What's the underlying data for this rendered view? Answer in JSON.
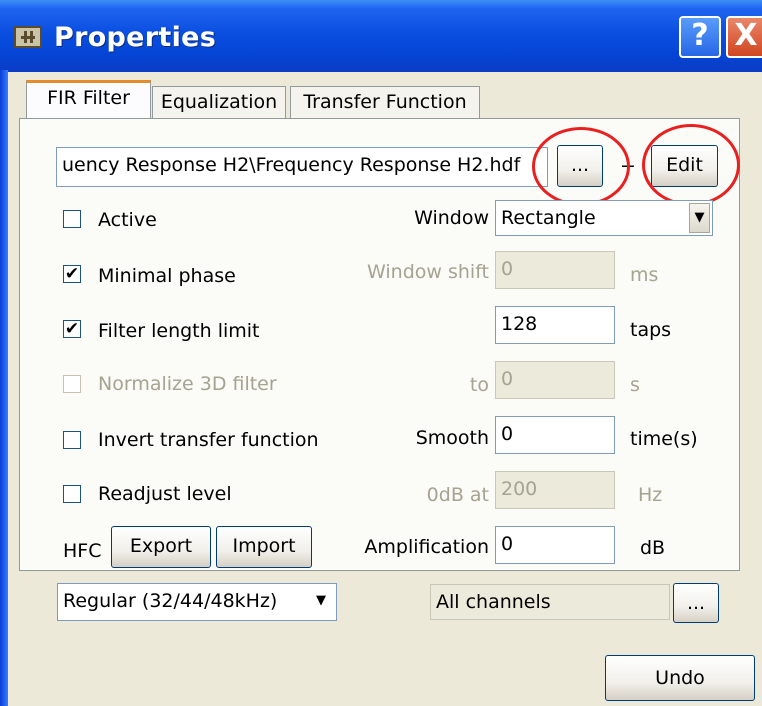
{
  "window": {
    "title": "Properties",
    "help_glyph": "?",
    "close_glyph": "X"
  },
  "tabs": [
    {
      "label": "FIR Filter",
      "active": true
    },
    {
      "label": "Equalization",
      "active": false
    },
    {
      "label": "Transfer Function",
      "active": false
    }
  ],
  "file": {
    "path": "uency Response H2\\Frequency Response H2.hdf",
    "browse_label": "...",
    "separator": "+",
    "edit_label": "Edit"
  },
  "options": {
    "active": {
      "label": "Active",
      "checked": false,
      "enabled": true
    },
    "minimal_phase": {
      "label": "Minimal phase",
      "checked": true,
      "enabled": true
    },
    "filter_length_limit": {
      "label": "Filter length limit",
      "checked": true,
      "enabled": true
    },
    "normalize_3d": {
      "label": "Normalize 3D filter",
      "checked": false,
      "enabled": false
    },
    "invert_transfer": {
      "label": "Invert transfer function",
      "checked": false,
      "enabled": true
    },
    "readjust_level": {
      "label": "Readjust level",
      "checked": false,
      "enabled": true
    }
  },
  "params": {
    "window": {
      "label": "Window",
      "value": "Rectangle"
    },
    "window_shift": {
      "label": "Window shift",
      "value": "0",
      "unit": "ms"
    },
    "taps": {
      "value": "128",
      "unit": "taps"
    },
    "to": {
      "label": "to",
      "value": "0",
      "unit": "s"
    },
    "smooth": {
      "label": "Smooth",
      "value": "0",
      "unit": "time(s)"
    },
    "odb_at": {
      "label": "0dB at",
      "value": "200",
      "unit": "Hz"
    },
    "amplification": {
      "label": "Amplification",
      "value": "0",
      "unit": "dB"
    }
  },
  "hfc": {
    "label": "HFC",
    "export_label": "Export",
    "import_label": "Import",
    "mode_value": "Regular (32/44/48kHz)"
  },
  "channels": {
    "value": "All channels",
    "browse_label": "..."
  },
  "footer": {
    "undo_label": "Undo"
  },
  "icons": {
    "check": "✔",
    "arrow_down": "▼"
  },
  "colors": {
    "titlebar": "#0a4fe0",
    "annotation": "#e8201f",
    "active_tab_accent": "#e68b2c"
  }
}
